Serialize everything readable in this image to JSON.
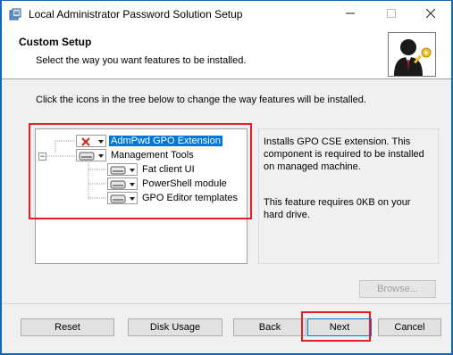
{
  "window": {
    "title": "Local Administrator Password Solution Setup",
    "controls": {
      "minimize_icon": "minimize-icon",
      "maximize_icon": "maximize-icon",
      "close_icon": "close-icon"
    }
  },
  "header": {
    "title": "Custom Setup",
    "subtitle": "Select the way you want features to be installed."
  },
  "instructions": "Click the icons in the tree below to change the way features will be installed.",
  "tree": {
    "items": [
      {
        "label": "AdmPwd GPO Extension",
        "state_icon": "red-x-icon",
        "selected": true
      },
      {
        "label": "Management Tools",
        "state_icon": "drive-icon",
        "selected": false
      },
      {
        "label": "Fat client UI",
        "state_icon": "drive-icon",
        "selected": false
      },
      {
        "label": "PowerShell module",
        "state_icon": "drive-icon",
        "selected": false
      },
      {
        "label": "GPO Editor templates",
        "state_icon": "drive-icon",
        "selected": false
      }
    ],
    "expander": "−"
  },
  "description": {
    "text1": "Installs GPO CSE extension. This component is required to be installed on managed machine.",
    "text2": "This feature requires 0KB on your hard drive."
  },
  "buttons": {
    "browse": "Browse...",
    "reset": "Reset",
    "disk_usage": "Disk Usage",
    "back": "Back",
    "next": "Next",
    "cancel": "Cancel"
  },
  "colors": {
    "accent": "#0078d7",
    "highlight": "#e41e26",
    "frame": "#1466b8"
  }
}
